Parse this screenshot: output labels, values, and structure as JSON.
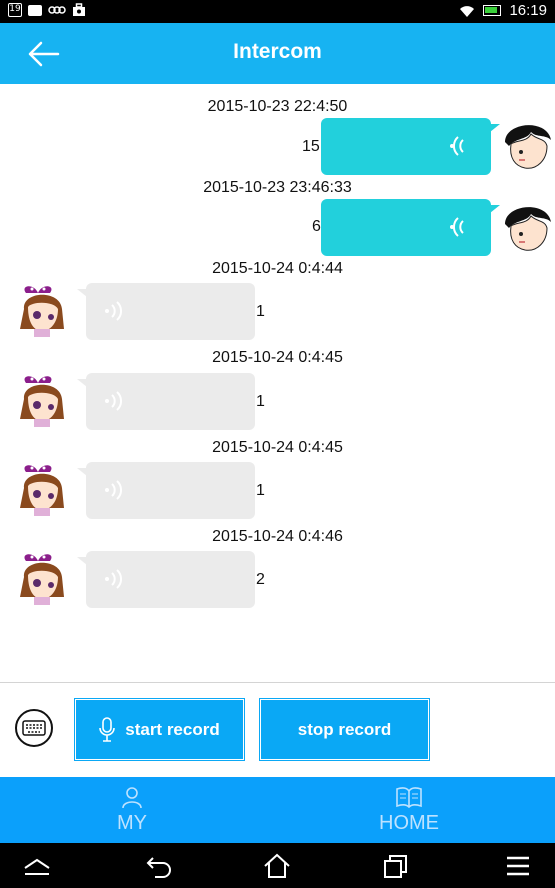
{
  "statusbar": {
    "time": "16:19",
    "icons": [
      "notification-19-icon",
      "image-icon",
      "eco-icon",
      "briefcase-icon"
    ],
    "battery_color": "#3cd13c"
  },
  "header": {
    "title": "Intercom",
    "back_icon": "arrow-left-icon",
    "color": "#17b3f2"
  },
  "messages": [
    {
      "side": "right",
      "timestamp": "2015-10-23 22:4:50",
      "duration": "15",
      "sender": "boy"
    },
    {
      "side": "right",
      "timestamp": "2015-10-23 23:46:33",
      "duration": "6",
      "sender": "boy"
    },
    {
      "side": "left",
      "timestamp": "2015-10-24 0:4:44",
      "duration": "1",
      "sender": "girl"
    },
    {
      "side": "left",
      "timestamp": "2015-10-24 0:4:45",
      "duration": "1",
      "sender": "girl"
    },
    {
      "side": "left",
      "timestamp": "2015-10-24 0:4:45",
      "duration": "1",
      "sender": "girl"
    },
    {
      "side": "left",
      "timestamp": "2015-10-24 0:4:46",
      "duration": "2",
      "sender": "girl"
    }
  ],
  "controls": {
    "start_label": "start record",
    "stop_label": "stop record",
    "keyboard_icon": "keyboard-icon",
    "mic_icon": "microphone-icon"
  },
  "nav": {
    "my_label": "MY",
    "home_label": "HOME"
  },
  "colors": {
    "sent_bubble": "#22d0dc",
    "received_bubble": "#ebebeb",
    "button": "#0aa8f5",
    "nav": "#0ba0fb"
  }
}
